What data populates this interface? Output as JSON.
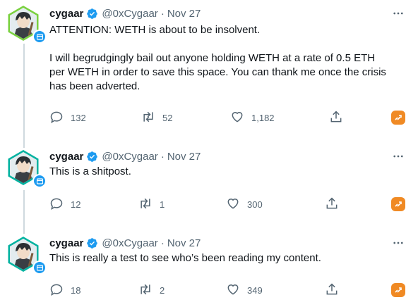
{
  "tweets": [
    {
      "name": "cygaar",
      "handle": "@0xCygaar",
      "separator": "·",
      "date": "Nov 27",
      "paragraphs": [
        "ATTENTION: WETH is about to be insolvent.",
        "I will begrudgingly bail out anyone holding WETH at a rate of 0.5 ETH per WETH in order to save this space. You can thank me once the crisis has been adverted."
      ],
      "replies": "132",
      "retweets": "52",
      "likes": "1,182"
    },
    {
      "name": "cygaar",
      "handle": "@0xCygaar",
      "separator": "·",
      "date": "Nov 27",
      "paragraphs": [
        "This is a shitpost."
      ],
      "replies": "12",
      "retweets": "1",
      "likes": "300"
    },
    {
      "name": "cygaar",
      "handle": "@0xCygaar",
      "separator": "·",
      "date": "Nov 27",
      "paragraphs": [
        "This is really a test to see who’s been reading my content."
      ],
      "replies": "18",
      "retweets": "2",
      "likes": "349"
    }
  ],
  "icons": {
    "verified": "verified-badge-icon",
    "more": "more-dots-icon",
    "reply": "reply-icon",
    "retweet": "retweet-icon",
    "like": "heart-icon",
    "share": "share-icon",
    "extension": "extension-icon"
  },
  "colors": {
    "accent": "#1d9bf0",
    "muted": "#536471",
    "extension": "#f08a24",
    "avatar_ring_first": "#7ad13f",
    "avatar_ring": "#00b2a0"
  }
}
